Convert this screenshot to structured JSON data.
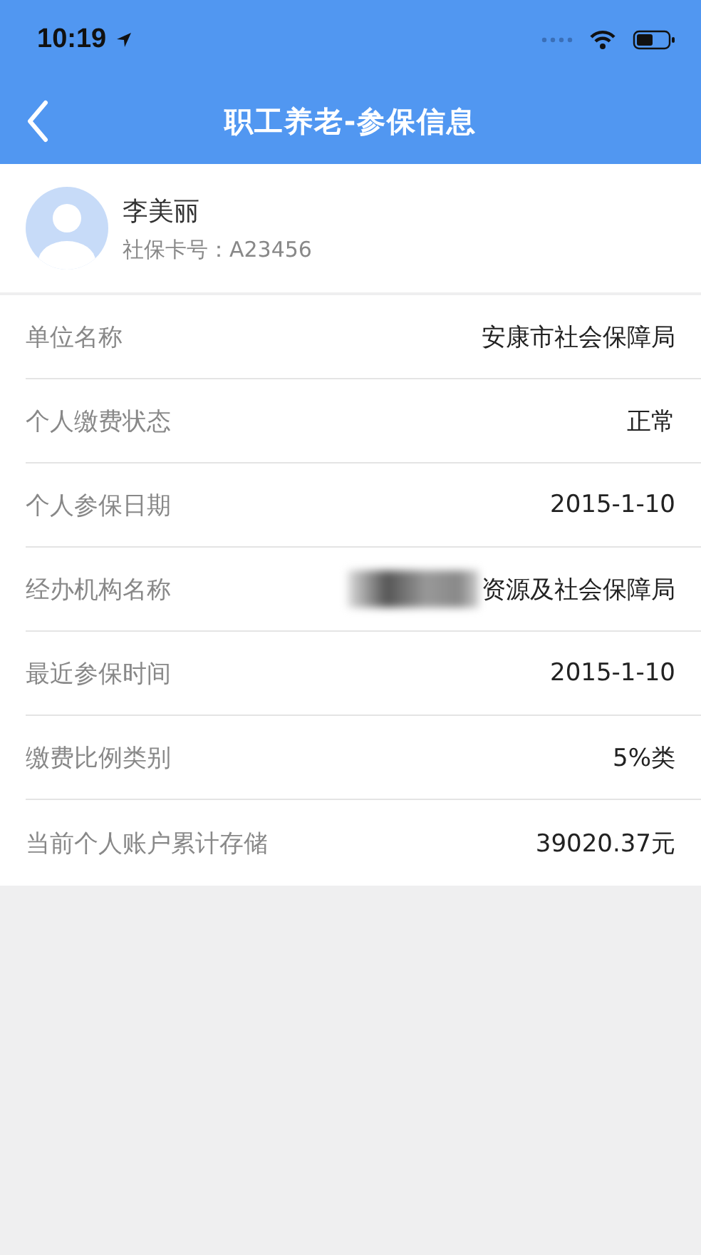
{
  "status_bar": {
    "time": "10:19"
  },
  "nav": {
    "title": "职工养老-参保信息"
  },
  "profile": {
    "name": "李美丽",
    "card_label": "社保卡号：",
    "card_number": "A23456"
  },
  "rows": [
    {
      "label": "单位名称",
      "value": "安康市社会保障局",
      "redacted": false
    },
    {
      "label": "个人缴费状态",
      "value": "正常",
      "redacted": false
    },
    {
      "label": "个人参保日期",
      "value": "2015-1-10",
      "redacted": false
    },
    {
      "label": "经办机构名称",
      "value": "资源及社会保障局",
      "redacted": true
    },
    {
      "label": "最近参保时间",
      "value": "2015-1-10",
      "redacted": false
    },
    {
      "label": "缴费比例类别",
      "value": "5%类",
      "redacted": false
    },
    {
      "label": "当前个人账户累计存储",
      "value": "39020.37元",
      "redacted": false
    }
  ]
}
